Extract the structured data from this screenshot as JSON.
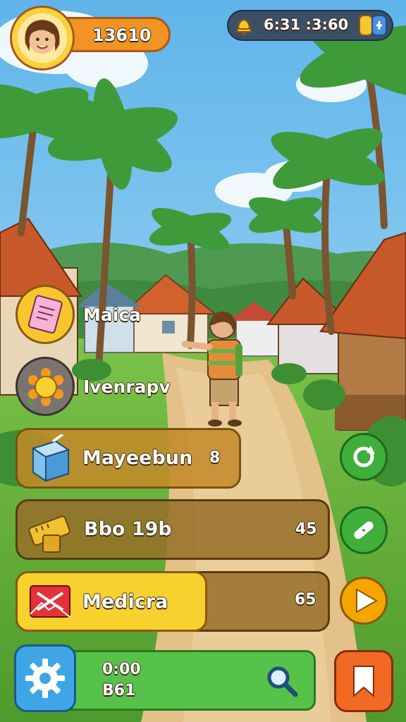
{
  "hud": {
    "score": "13610",
    "clock": "6:31 :3:60",
    "avatar_icon": "woman-face-icon",
    "bell_icon": "bell-icon",
    "battery_icon": "battery-icon"
  },
  "left_menu": [
    {
      "label": "Maica",
      "icon": "note-icon"
    },
    {
      "label": "Ivenrapv",
      "icon": "sun-badge-icon"
    }
  ],
  "quests": [
    {
      "label": "Mayeebun",
      "value": "8",
      "icon": "milk-box-icon"
    },
    {
      "label": "Bbo 19b",
      "value": "45",
      "icon": "tape-measure-icon"
    },
    {
      "label": "Medicra",
      "value": "65",
      "icon": "medical-kit-icon"
    }
  ],
  "right_buttons": [
    {
      "icon": "refresh-icon",
      "color": "#3fae3a"
    },
    {
      "icon": "bandage-icon",
      "color": "#3fae3a"
    },
    {
      "icon": "play-icon",
      "color": "#f5a400"
    }
  ],
  "bottom_bar": {
    "time_line1": "0:00",
    "time_line2": "B61",
    "settings_icon": "gear-icon",
    "search_icon": "search-icon",
    "bookmark_icon": "bookmark-icon"
  },
  "colors": {
    "sky": "#9ed7f3",
    "grass": "#6cbb3c",
    "path": "#e7c98d",
    "score_orange": "#f39323",
    "bar_green": "#57c24a",
    "settings_blue": "#3ea6e6",
    "bookmark_orange": "#f06a24"
  }
}
